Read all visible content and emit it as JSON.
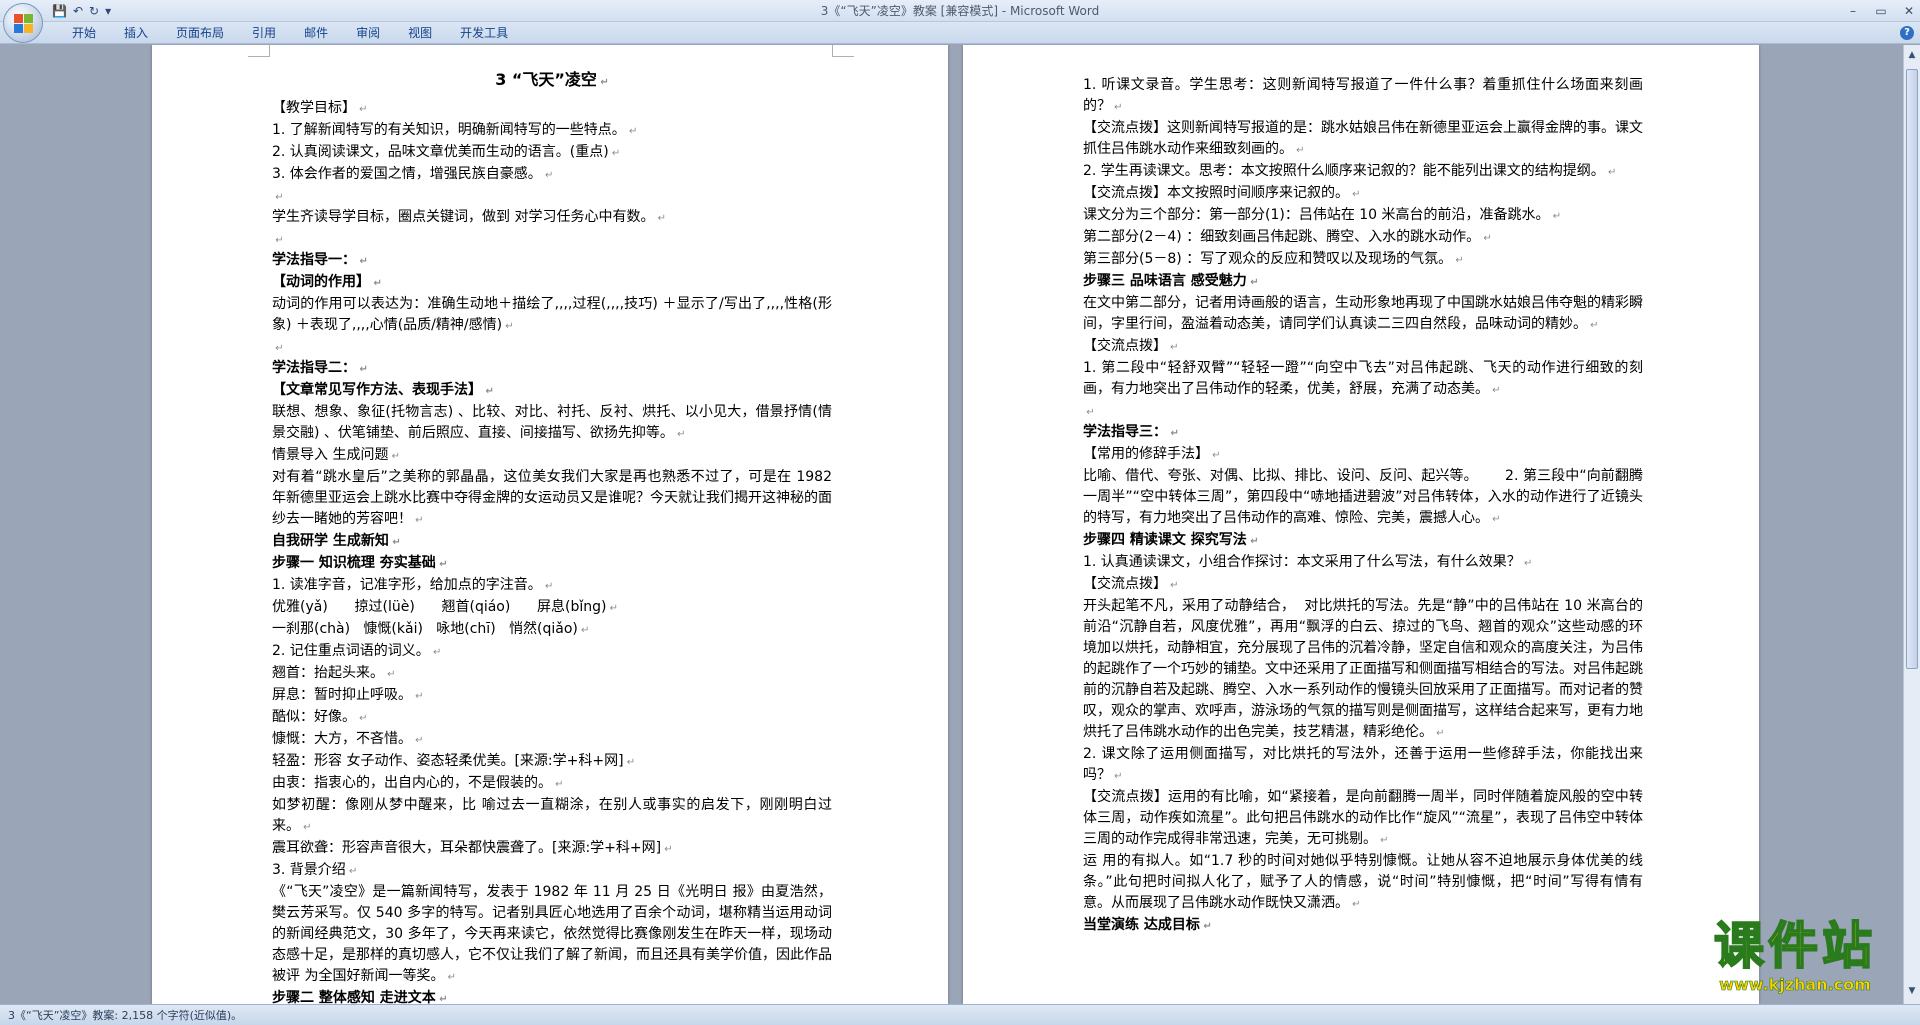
{
  "window": {
    "title": "3《“飞天”凌空》教案 [兼容模式] - Microsoft Word"
  },
  "quick_access": {
    "save_icon": "💾",
    "undo_icon": "↶",
    "redo_icon": "↻",
    "customize_icon": "▾"
  },
  "ribbon": {
    "tabs": [
      "开始",
      "插入",
      "页面布局",
      "引用",
      "邮件",
      "审阅",
      "视图",
      "开发工具"
    ],
    "help": "?"
  },
  "document": {
    "left_page": [
      {
        "t": "3 “飞天”凌空",
        "s": "title"
      },
      {
        "t": "【教学目标】",
        "s": ""
      },
      {
        "t": "1. 了解新闻特写的有关知识，明确新闻特写的一些特点。",
        "s": ""
      },
      {
        "t": "2. 认真阅读课文，品味文章优美而生动的语言。(重点)",
        "s": ""
      },
      {
        "t": "3. 体会作者的爱国之情，增强民族自豪感。",
        "s": ""
      },
      {
        "t": "",
        "s": "blank"
      },
      {
        "t": "学生齐读导学目标，圈点关键词，做到 对学习任务心中有数。",
        "s": ""
      },
      {
        "t": "",
        "s": "blank"
      },
      {
        "t": "学法指导一：",
        "s": "bold"
      },
      {
        "t": "【动词的作用】",
        "s": "bold"
      },
      {
        "t": "动词的作用可以表达为：准确生动地＋描绘了,,,,过程(,,,,技巧) ＋显示了/写出了,,,,性格(形象) ＋表现了,,,,心情(品质/精神/感情)",
        "s": ""
      },
      {
        "t": "",
        "s": "blank"
      },
      {
        "t": "学法指导二：",
        "s": "bold"
      },
      {
        "t": "【文章常见写作方法、表现手法】",
        "s": "bold"
      },
      {
        "t": "联想、想象、象征(托物言志) 、比较、对比、衬托、反衬、烘托、以小见大，借景抒情(情景交融) 、伏笔铺垫、前后照应、直接、间接描写、欲扬先抑等。",
        "s": ""
      },
      {
        "t": "情景导入 生成问题",
        "s": ""
      },
      {
        "t": "对有着“跳水皇后”之美称的郭晶晶，这位美女我们大家是再也熟悉不过了，可是在 1982 年新德里亚运会上跳水比赛中夺得金牌的女运动员又是谁呢？今天就让我们揭开这神秘的面纱去一睹她的芳容吧！",
        "s": ""
      },
      {
        "t": "自我研学 生成新知",
        "s": "bold"
      },
      {
        "t": "步骤一 知识梳理 夯实基础",
        "s": "bold"
      },
      {
        "t": "1. 读准字音，记准字形，给加点的字注音。",
        "s": ""
      },
      {
        "t": "优雅(yǎ)      掠过(lüè)      翘首(qiáo)      屏息(bǐng)",
        "s": ""
      },
      {
        "t": "一刹那(chà)   慷慨(kǎi)   咏地(chī)   悄然(qiǎo)",
        "s": ""
      },
      {
        "t": "2. 记住重点词语的词义。",
        "s": ""
      },
      {
        "t": "翘首：抬起头来。",
        "s": ""
      },
      {
        "t": "屏息：暂时抑止呼吸。",
        "s": ""
      },
      {
        "t": "酷似：好像。",
        "s": ""
      },
      {
        "t": "慷慨：大方，不吝惜。",
        "s": ""
      },
      {
        "t": "轻盈：形容 女子动作、姿态轻柔优美。[来源:学+科+网]",
        "s": ""
      },
      {
        "t": "由衷：指衷心的，出自内心的，不是假装的。",
        "s": ""
      },
      {
        "t": "如梦初醒：像刚从梦中醒来，比 喻过去一直糊涂，在别人或事实的启发下，刚刚明白过来。",
        "s": ""
      },
      {
        "t": "震耳欲聋：形容声音很大，耳朵都快震聋了。[来源:学+科+网]",
        "s": ""
      },
      {
        "t": "3. 背景介绍",
        "s": ""
      },
      {
        "t": "《“飞天”凌空》是一篇新闻特写，发表于 1982 年 11 月 25 日《光明日 报》由夏浩然，樊云芳采写。仅 540 多字的特写。记者别具匠心地选用了百余个动词，堪称精当运用动词的新闻经典范文，30 多年了，今天再来读它，依然觉得比赛像刚发生在昨天一样，现场动态感十足，是那样的真切感人，它不仅让我们了解了新闻，而且还具有美学价值，因此作品被评 为全国好新闻一等奖。",
        "s": ""
      },
      {
        "t": "步骤二 整体感知 走进文本",
        "s": "bold"
      }
    ],
    "right_page": [
      {
        "t": "1. 听课文录音。学生思考：这则新闻特写报道了一件什么事？着重抓住什么场面来刻画的？",
        "s": ""
      },
      {
        "t": "【交流点拨】这则新闻特写报道的是：跳水姑娘吕伟在新德里亚运会上赢得金牌的事。课文抓住吕伟跳水动作来细致刻画的。",
        "s": ""
      },
      {
        "t": "2. 学生再读课文。思考：本文按照什么顺序来记叙的？能不能列出课文的结构提纲。",
        "s": ""
      },
      {
        "t": "【交流点拨】本文按照时间顺序来记叙的。",
        "s": ""
      },
      {
        "t": "课文分为三个部分：第一部分(1)：吕伟站在 10 米高台的前沿，准备跳水。",
        "s": ""
      },
      {
        "t": "第二部分(2－4) ：细致刻画吕伟起跳、腾空、入水的跳水动作。",
        "s": ""
      },
      {
        "t": "第三部分(5－8) ：写了观众的反应和赞叹以及现场的气氛。",
        "s": ""
      },
      {
        "t": "步骤三 品味语言 感受魅力",
        "s": "bold"
      },
      {
        "t": "在文中第二部分，记者用诗画般的语言，生动形象地再现了中国跳水姑娘吕伟夺魁的精彩瞬间，字里行间，盈溢着动态美，请同学们认真读二三四自然段，品味动词的精妙。",
        "s": ""
      },
      {
        "t": "【交流点拨】",
        "s": ""
      },
      {
        "t": "1. 第二段中“轻舒双臂”“轻轻一蹬”“向空中飞去”对吕伟起跳、飞天的动作进行细致的刻画，有力地突出了吕伟动作的轻柔，优美，舒展，充满了动态美。",
        "s": ""
      },
      {
        "t": "",
        "s": "blank"
      },
      {
        "t": "学法指导三：",
        "s": "bold"
      },
      {
        "t": "【常用的修辞手法】",
        "s": ""
      },
      {
        "t": "比喻、借代、夸张、对偶、比拟、排比、设问、反问、起兴等。      2. 第三段中“向前翻腾一周半”“空中转体三周”，第四段中“哧地插进碧波”对吕伟转体，入水的动作进行了近镜头的特写，有力地突出了吕伟动作的高难、惊险、完美，震撼人心。",
        "s": ""
      },
      {
        "t": "步骤四 精读课文 探究写法",
        "s": "bold"
      },
      {
        "t": "1. 认真通读课文，小组合作探讨：本文采用了什么写法，有什么效果？",
        "s": ""
      },
      {
        "t": "【交流点拨】",
        "s": ""
      },
      {
        "t": "开头起笔不凡，采用了动静结合，  对比烘托的写法。先是“静”中的吕伟站在 10 米高台的前沿“沉静自若，风度优雅”，再用“飘浮的白云、掠过的飞鸟、翘首的观众”这些动感的环境加以烘托，动静相宜，充分展现了吕伟的沉着冷静，坚定自信和观众的高度关注，为吕伟的起跳作了一个巧妙的铺垫。文中还采用了正面描写和侧面描写相结合的写法。对吕伟起跳前的沉静自若及起跳、腾空、入水一系列动作的慢镜头回放采用了正面描写。而对记者的赞叹，观众的掌声、欢呼声，游泳场的气氛的描写则是侧面描写，这样结合起来写，更有力地烘托了吕伟跳水动作的出色完美，技艺精湛，精彩绝伦。",
        "s": ""
      },
      {
        "t": "2. 课文除了运用侧面描写，对比烘托的写法外，还善于运用一些修辞手法，你能找出来吗？",
        "s": ""
      },
      {
        "t": "【交流点拨】运用的有比喻，如“紧接着，是向前翻腾一周半，同时伴随着旋风般的空中转体三周，动作疾如流星”。此句把吕伟跳水的动作比作“旋风”“流星”，表现了吕伟空中转体三周的动作完成得非常迅速，完美，无可挑剔。",
        "s": ""
      },
      {
        "t": "运 用的有拟人。如“1.7 秒的时间对她似乎特别慷慨。让她从容不迫地展示身体优美的线条。”此句把时间拟人化了，赋予了人的情感，说“时间”特别慷慨，把“时间”写得有情有意。从而展现了吕伟跳水动作既快又潇洒。",
        "s": ""
      },
      {
        "t": "当堂演练 达成目标",
        "s": "bold"
      }
    ]
  },
  "status_bar": {
    "text": "3《“飞天”凌空》教案: 2,158 个字符(近似值)。"
  },
  "watermark": {
    "main": "课件站",
    "url": "www.kjzhan.com"
  },
  "colors": {
    "accent": "#15428b",
    "watermark_fill": "#ffd200",
    "watermark_stroke": "#2a7a1e"
  }
}
